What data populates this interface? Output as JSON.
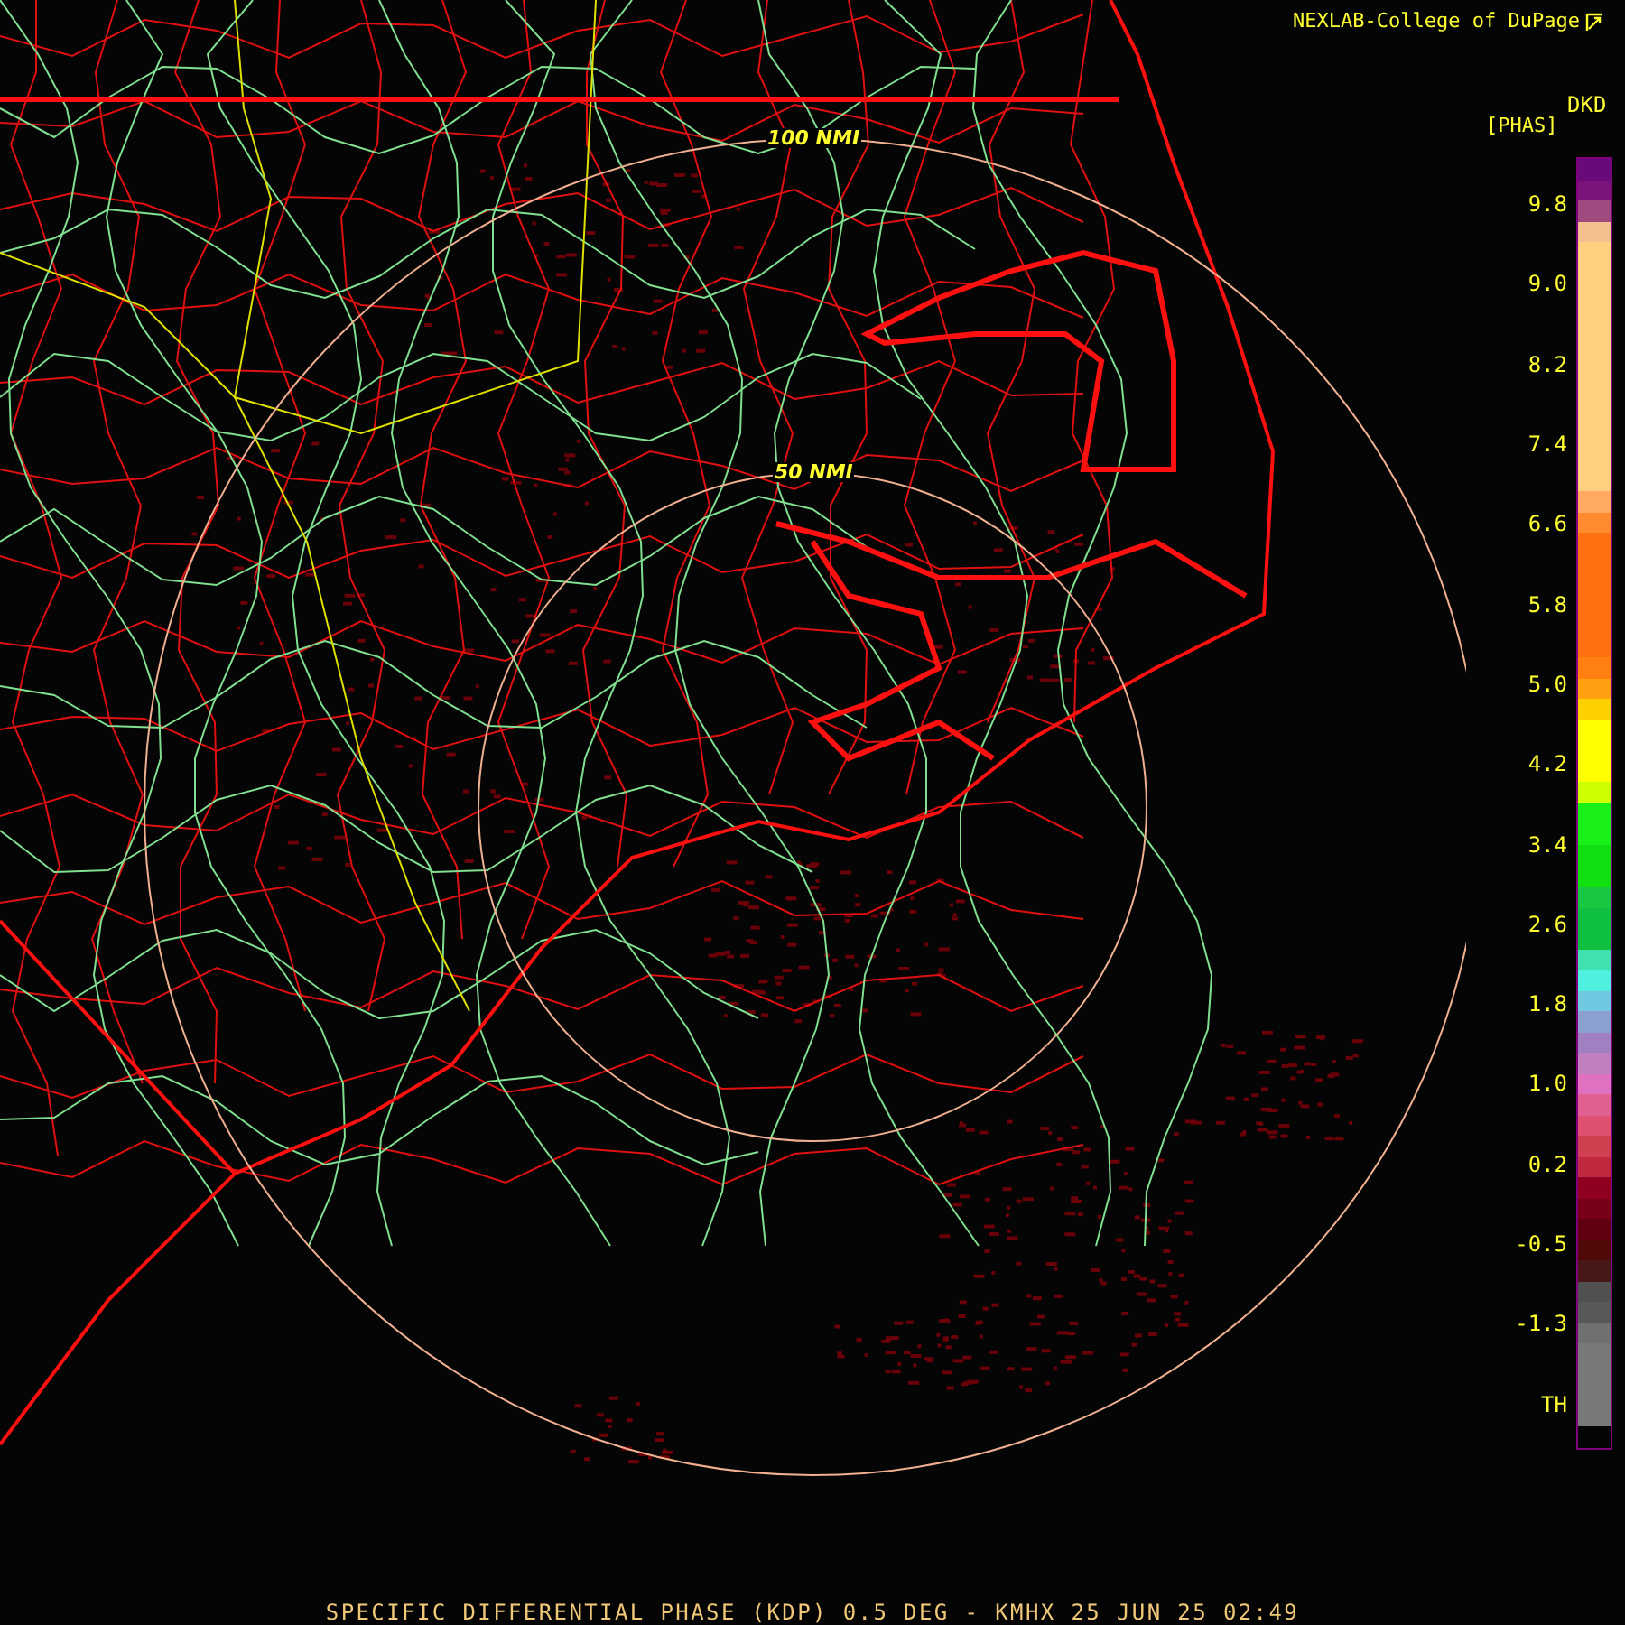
{
  "header": {
    "credit": "NEXLAB-College of DuPage"
  },
  "legend": {
    "product": "DKD",
    "units": "[PHAS]",
    "labels": [
      "9.8",
      "9.0",
      "8.2",
      "7.4",
      "6.6",
      "5.8",
      "5.0",
      "4.2",
      "3.4",
      "2.6",
      "1.8",
      "1.0",
      "0.2",
      "-0.5",
      "-1.3",
      "TH"
    ],
    "segments": [
      {
        "color": "#6a0a7a"
      },
      {
        "color": "#7a1478"
      },
      {
        "color": "#a04a80"
      },
      {
        "color": "#f4c090"
      },
      {
        "color": "#ffd080"
      },
      {
        "color": "#ffd080"
      },
      {
        "color": "#ffd080"
      },
      {
        "color": "#ffd080"
      },
      {
        "color": "#ffd080"
      },
      {
        "color": "#ffd080"
      },
      {
        "color": "#ffd080"
      },
      {
        "color": "#ffd080"
      },
      {
        "color": "#ffd080"
      },
      {
        "color": "#ffd080"
      },
      {
        "color": "#ffd080"
      },
      {
        "color": "#ffd080"
      },
      {
        "color": "#ffaa60"
      },
      {
        "color": "#ff8a30"
      },
      {
        "color": "#ff7010"
      },
      {
        "color": "#ff7010"
      },
      {
        "color": "#ff7010"
      },
      {
        "color": "#ff7010"
      },
      {
        "color": "#ff7010"
      },
      {
        "color": "#ff7010"
      },
      {
        "color": "#ff7f10"
      },
      {
        "color": "#ffa010"
      },
      {
        "color": "#ffd000"
      },
      {
        "color": "#ffff00"
      },
      {
        "color": "#ffff00"
      },
      {
        "color": "#ffff00"
      },
      {
        "color": "#ccff00"
      },
      {
        "color": "#18f018"
      },
      {
        "color": "#18f018"
      },
      {
        "color": "#10e010"
      },
      {
        "color": "#10e010"
      },
      {
        "color": "#18c840"
      },
      {
        "color": "#10c040"
      },
      {
        "color": "#10c040"
      },
      {
        "color": "#40e0b0"
      },
      {
        "color": "#50f0e0"
      },
      {
        "color": "#70c8e0"
      },
      {
        "color": "#8ca0d0"
      },
      {
        "color": "#a080c0"
      },
      {
        "color": "#c080c0"
      },
      {
        "color": "#e070c0"
      },
      {
        "color": "#e06090"
      },
      {
        "color": "#e05070"
      },
      {
        "color": "#d04050"
      },
      {
        "color": "#c02840"
      },
      {
        "color": "#900020"
      },
      {
        "color": "#780018"
      },
      {
        "color": "#600010"
      },
      {
        "color": "#500808"
      },
      {
        "color": "#481818"
      },
      {
        "color": "#505050"
      },
      {
        "color": "#585858"
      },
      {
        "color": "#707070"
      },
      {
        "color": "#787878"
      },
      {
        "color": "#787878"
      },
      {
        "color": "#787878"
      },
      {
        "color": "#787878"
      }
    ]
  },
  "rings": [
    {
      "label": "100 NMI"
    },
    {
      "label": "50 NMI"
    }
  ],
  "caption": "SPECIFIC DIFFERENTIAL PHASE (KDP) 0.5 DEG - KMHX 25 JUN 25 02:49"
}
